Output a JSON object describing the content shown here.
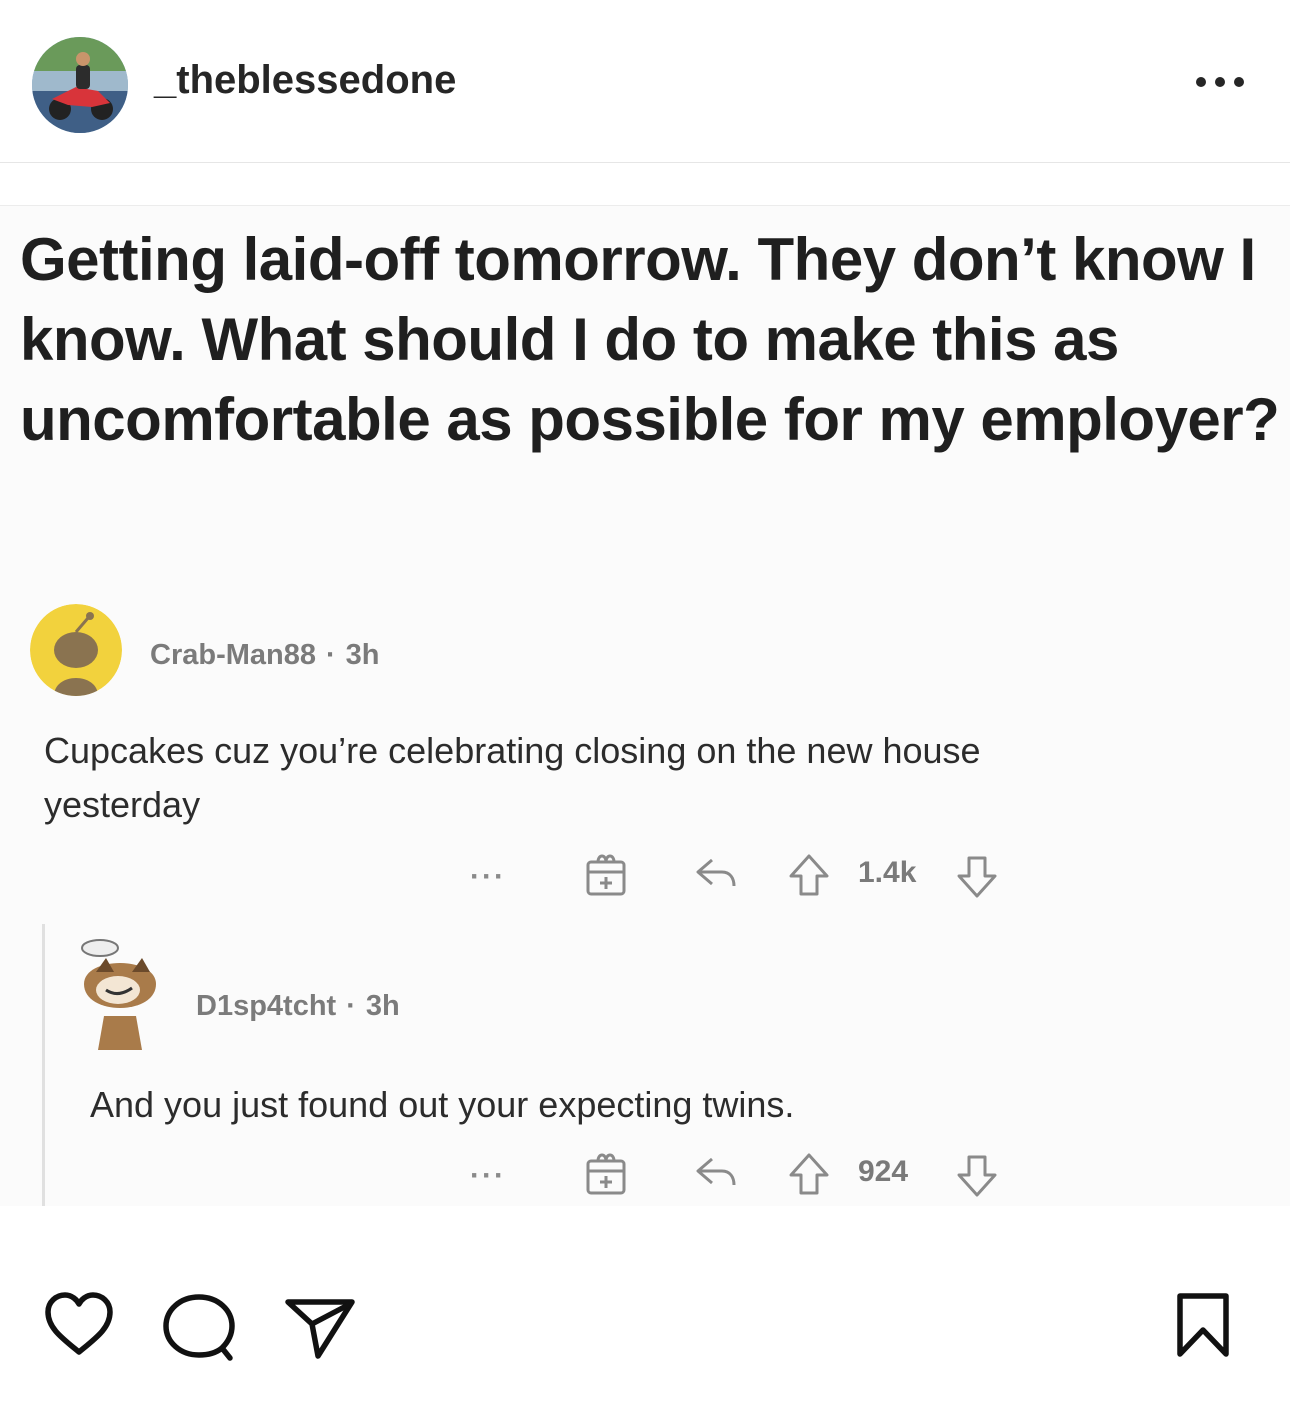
{
  "post_header": {
    "username": "_theblessedone",
    "avatar_icon": "profile-photo-motorcycle",
    "more_icon": "more-options-icon"
  },
  "post": {
    "title": "Getting laid-off tomorrow. They don’t know I know. What should I do to make this as uncomfortable as possible for my employer?",
    "comments": [
      {
        "author": "Crab-Man88",
        "separator": "·",
        "age": "3h",
        "body": "Cupcakes cuz you’re celebrating closing on the new house yesterday",
        "more": "···",
        "votes": "1.4k"
      },
      {
        "author": "D1sp4tcht",
        "separator": "·",
        "age": "3h",
        "body": "And you just found out your expecting twins.",
        "more": "···",
        "votes": "924"
      }
    ]
  },
  "actions": {
    "like_icon": "heart-icon",
    "comment_icon": "comment-icon",
    "share_icon": "send-icon",
    "save_icon": "bookmark-icon"
  },
  "colors": {
    "text_primary": "#262626",
    "reddit_muted": "#7b7b7b",
    "avatar_yellow": "#f2d23d"
  }
}
